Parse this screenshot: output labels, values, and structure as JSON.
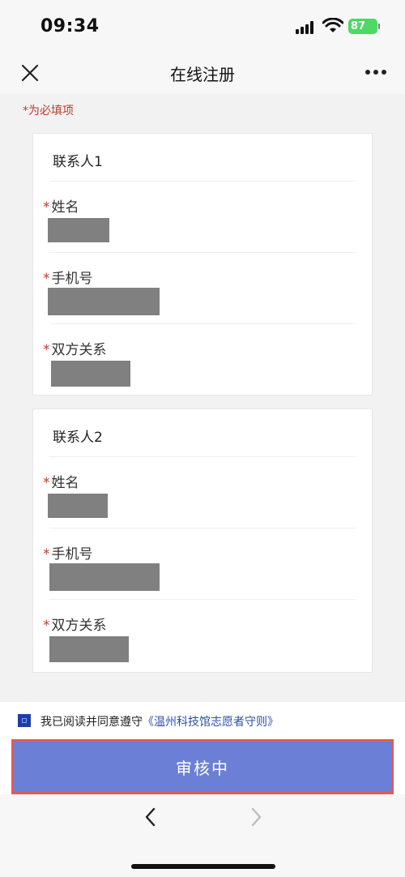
{
  "status_bar": {
    "time": "09:34",
    "battery": "87"
  },
  "nav": {
    "title": "在线注册",
    "close_icon": "close-icon",
    "more_icon": "more-icon"
  },
  "form": {
    "required_note": "*为必填项",
    "contacts": [
      {
        "title": "联系人1",
        "fields": [
          {
            "required_mark": "*",
            "label": "姓名"
          },
          {
            "required_mark": "*",
            "label": "手机号"
          },
          {
            "required_mark": "*",
            "label": "双方关系"
          }
        ]
      },
      {
        "title": "联系人2",
        "fields": [
          {
            "required_mark": "*",
            "label": "姓名"
          },
          {
            "required_mark": "*",
            "label": "手机号"
          },
          {
            "required_mark": "*",
            "label": "双方关系"
          }
        ]
      }
    ]
  },
  "agreement": {
    "text": "我已阅读并同意遵守",
    "link": "《温州科技馆志愿者守则》"
  },
  "submit": {
    "label": "审核中"
  },
  "colors": {
    "accent_button": "#6b7fd6",
    "required_red": "#c0392b",
    "link_blue": "#2c4fa8"
  }
}
